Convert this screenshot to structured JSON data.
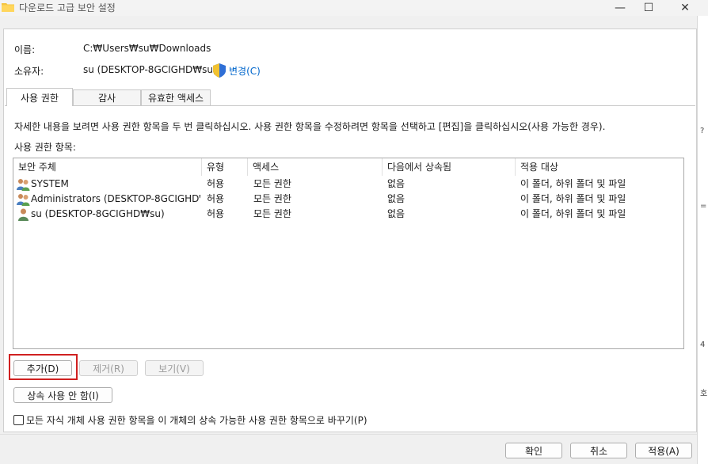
{
  "window": {
    "title": "다운로드 고급 보안 설정",
    "minimize": "—",
    "maximize": "☐",
    "close": "✕"
  },
  "header": {
    "name_label": "이름:",
    "name_value": "C:₩Users₩su₩Downloads",
    "owner_label": "소유자:",
    "owner_value": "su (DESKTOP-8GCIGHD₩su)",
    "change_link": "변경(C)"
  },
  "tabs": [
    {
      "label": "사용 권한",
      "active": true
    },
    {
      "label": "감사",
      "active": false
    },
    {
      "label": "유효한 액세스",
      "active": false
    }
  ],
  "info_text": "자세한 내용을 보려면 사용 권한 항목을 두 번 클릭하십시오. 사용 권한 항목을 수정하려면 항목을 선택하고 [편집]을 클릭하십시오(사용 가능한 경우).",
  "entries_label": "사용 권한 항목:",
  "table": {
    "columns": [
      "보안 주체",
      "유형",
      "액세스",
      "다음에서 상속됨",
      "적용 대상"
    ],
    "rows": [
      {
        "icon": "group-users-icon",
        "principal": "SYSTEM",
        "type": "허용",
        "access": "모든 권한",
        "inherited": "없음",
        "applies": "이 폴더, 하위 폴더 및 파일"
      },
      {
        "icon": "group-users-icon",
        "principal": "Administrators (DESKTOP-8GCIGHD₩...",
        "type": "허용",
        "access": "모든 권한",
        "inherited": "없음",
        "applies": "이 폴더, 하위 폴더 및 파일"
      },
      {
        "icon": "single-user-icon",
        "principal": "su (DESKTOP-8GCIGHD₩su)",
        "type": "허용",
        "access": "모든 권한",
        "inherited": "없음",
        "applies": "이 폴더, 하위 폴더 및 파일"
      }
    ]
  },
  "buttons": {
    "add": "추가(D)",
    "remove": "제거(R)",
    "view": "보기(V)",
    "disable_inheritance": "상속 사용 안 함(I)",
    "ok": "확인",
    "cancel": "취소",
    "apply": "적용(A)"
  },
  "replace_checkbox_label": "모든 자식 개체 사용 권한 항목을 이 개체의 상속 가능한 사용 권한 항목으로 바꾸기(P)",
  "strip_marks": [
    "?",
    "=",
    "4",
    "호"
  ],
  "colors": {
    "accent": "#0066cc",
    "highlight": "#d02020"
  }
}
